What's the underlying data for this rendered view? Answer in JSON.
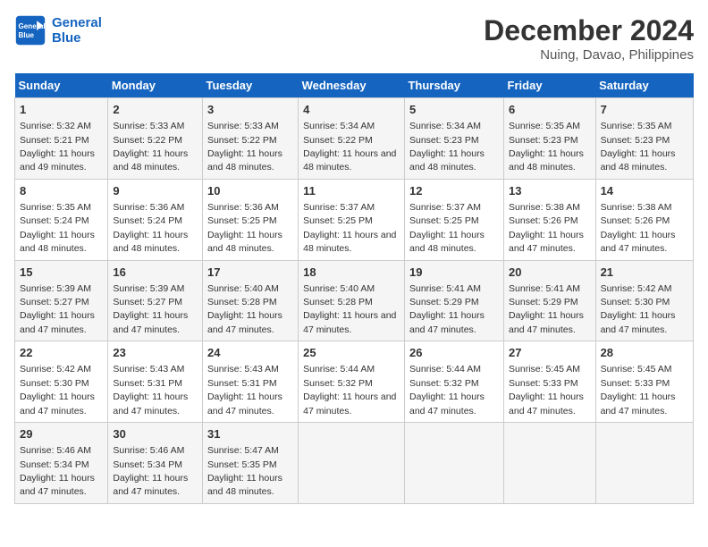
{
  "header": {
    "logo_line1": "General",
    "logo_line2": "Blue",
    "main_title": "December 2024",
    "subtitle": "Nuing, Davao, Philippines"
  },
  "calendar": {
    "days_of_week": [
      "Sunday",
      "Monday",
      "Tuesday",
      "Wednesday",
      "Thursday",
      "Friday",
      "Saturday"
    ],
    "weeks": [
      [
        {
          "day": "1",
          "sunrise": "5:32 AM",
          "sunset": "5:21 PM",
          "daylight": "11 hours and 49 minutes."
        },
        {
          "day": "2",
          "sunrise": "5:33 AM",
          "sunset": "5:22 PM",
          "daylight": "11 hours and 48 minutes."
        },
        {
          "day": "3",
          "sunrise": "5:33 AM",
          "sunset": "5:22 PM",
          "daylight": "11 hours and 48 minutes."
        },
        {
          "day": "4",
          "sunrise": "5:34 AM",
          "sunset": "5:22 PM",
          "daylight": "11 hours and 48 minutes."
        },
        {
          "day": "5",
          "sunrise": "5:34 AM",
          "sunset": "5:23 PM",
          "daylight": "11 hours and 48 minutes."
        },
        {
          "day": "6",
          "sunrise": "5:35 AM",
          "sunset": "5:23 PM",
          "daylight": "11 hours and 48 minutes."
        },
        {
          "day": "7",
          "sunrise": "5:35 AM",
          "sunset": "5:23 PM",
          "daylight": "11 hours and 48 minutes."
        }
      ],
      [
        {
          "day": "8",
          "sunrise": "5:35 AM",
          "sunset": "5:24 PM",
          "daylight": "11 hours and 48 minutes."
        },
        {
          "day": "9",
          "sunrise": "5:36 AM",
          "sunset": "5:24 PM",
          "daylight": "11 hours and 48 minutes."
        },
        {
          "day": "10",
          "sunrise": "5:36 AM",
          "sunset": "5:25 PM",
          "daylight": "11 hours and 48 minutes."
        },
        {
          "day": "11",
          "sunrise": "5:37 AM",
          "sunset": "5:25 PM",
          "daylight": "11 hours and 48 minutes."
        },
        {
          "day": "12",
          "sunrise": "5:37 AM",
          "sunset": "5:25 PM",
          "daylight": "11 hours and 48 minutes."
        },
        {
          "day": "13",
          "sunrise": "5:38 AM",
          "sunset": "5:26 PM",
          "daylight": "11 hours and 47 minutes."
        },
        {
          "day": "14",
          "sunrise": "5:38 AM",
          "sunset": "5:26 PM",
          "daylight": "11 hours and 47 minutes."
        }
      ],
      [
        {
          "day": "15",
          "sunrise": "5:39 AM",
          "sunset": "5:27 PM",
          "daylight": "11 hours and 47 minutes."
        },
        {
          "day": "16",
          "sunrise": "5:39 AM",
          "sunset": "5:27 PM",
          "daylight": "11 hours and 47 minutes."
        },
        {
          "day": "17",
          "sunrise": "5:40 AM",
          "sunset": "5:28 PM",
          "daylight": "11 hours and 47 minutes."
        },
        {
          "day": "18",
          "sunrise": "5:40 AM",
          "sunset": "5:28 PM",
          "daylight": "11 hours and 47 minutes."
        },
        {
          "day": "19",
          "sunrise": "5:41 AM",
          "sunset": "5:29 PM",
          "daylight": "11 hours and 47 minutes."
        },
        {
          "day": "20",
          "sunrise": "5:41 AM",
          "sunset": "5:29 PM",
          "daylight": "11 hours and 47 minutes."
        },
        {
          "day": "21",
          "sunrise": "5:42 AM",
          "sunset": "5:30 PM",
          "daylight": "11 hours and 47 minutes."
        }
      ],
      [
        {
          "day": "22",
          "sunrise": "5:42 AM",
          "sunset": "5:30 PM",
          "daylight": "11 hours and 47 minutes."
        },
        {
          "day": "23",
          "sunrise": "5:43 AM",
          "sunset": "5:31 PM",
          "daylight": "11 hours and 47 minutes."
        },
        {
          "day": "24",
          "sunrise": "5:43 AM",
          "sunset": "5:31 PM",
          "daylight": "11 hours and 47 minutes."
        },
        {
          "day": "25",
          "sunrise": "5:44 AM",
          "sunset": "5:32 PM",
          "daylight": "11 hours and 47 minutes."
        },
        {
          "day": "26",
          "sunrise": "5:44 AM",
          "sunset": "5:32 PM",
          "daylight": "11 hours and 47 minutes."
        },
        {
          "day": "27",
          "sunrise": "5:45 AM",
          "sunset": "5:33 PM",
          "daylight": "11 hours and 47 minutes."
        },
        {
          "day": "28",
          "sunrise": "5:45 AM",
          "sunset": "5:33 PM",
          "daylight": "11 hours and 47 minutes."
        }
      ],
      [
        {
          "day": "29",
          "sunrise": "5:46 AM",
          "sunset": "5:34 PM",
          "daylight": "11 hours and 47 minutes."
        },
        {
          "day": "30",
          "sunrise": "5:46 AM",
          "sunset": "5:34 PM",
          "daylight": "11 hours and 47 minutes."
        },
        {
          "day": "31",
          "sunrise": "5:47 AM",
          "sunset": "5:35 PM",
          "daylight": "11 hours and 48 minutes."
        },
        null,
        null,
        null,
        null
      ]
    ],
    "label_sunrise": "Sunrise:",
    "label_sunset": "Sunset:",
    "label_daylight": "Daylight:"
  }
}
